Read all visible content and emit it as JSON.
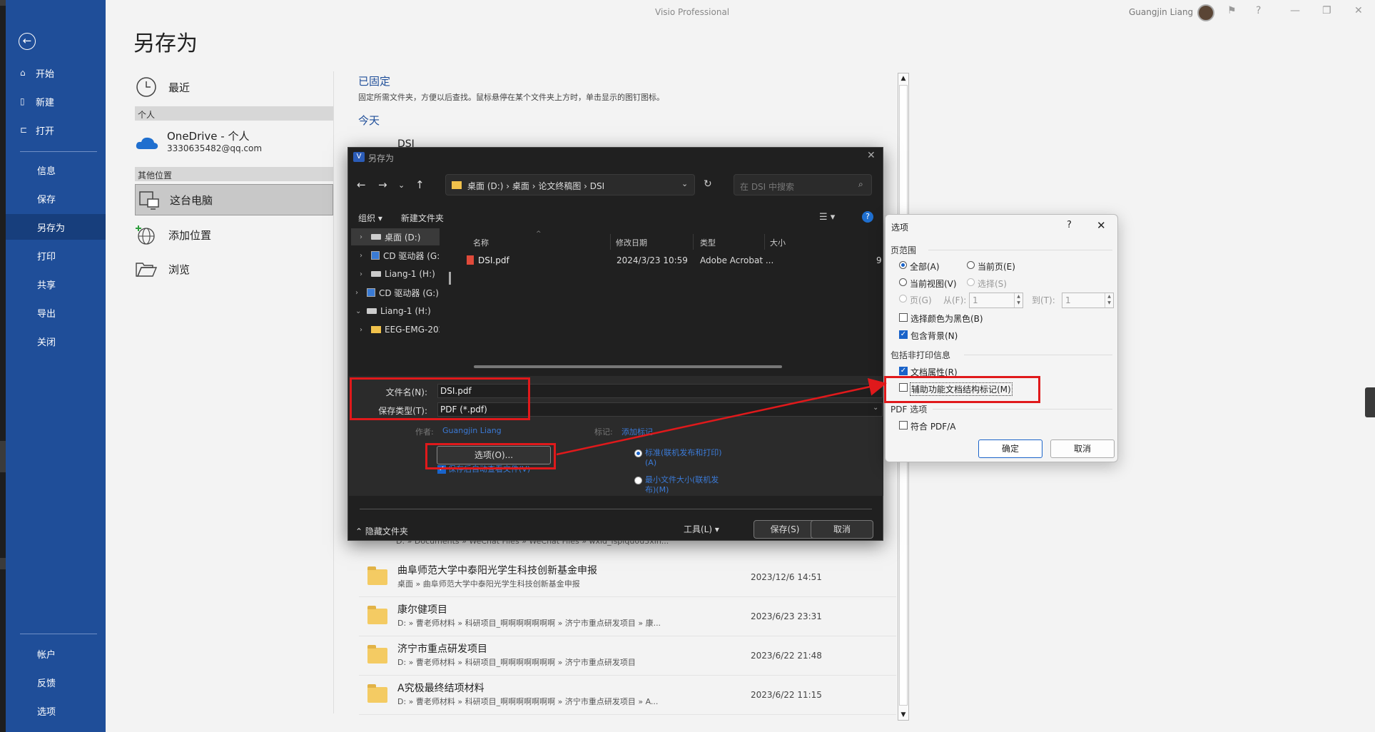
{
  "app": {
    "title": "Visio Professional",
    "user": "Guangjin Liang"
  },
  "titlebar_icons": [
    "comment-icon",
    "help-icon",
    "minimize-icon",
    "restore-icon",
    "close-icon"
  ],
  "nav": {
    "top": [
      {
        "label": "开始",
        "icon": "home-icon"
      },
      {
        "label": "新建",
        "icon": "new-icon"
      },
      {
        "label": "打开",
        "icon": "open-icon"
      }
    ],
    "mid": [
      {
        "label": "信息"
      },
      {
        "label": "保存"
      },
      {
        "label": "另存为",
        "selected": true
      },
      {
        "label": "打印"
      },
      {
        "label": "共享"
      },
      {
        "label": "导出"
      },
      {
        "label": "关闭"
      }
    ],
    "bottom": [
      {
        "label": "帐户"
      },
      {
        "label": "反馈"
      },
      {
        "label": "选项"
      }
    ]
  },
  "backstage": {
    "title": "另存为",
    "recent": "最近",
    "personal_header": "个人",
    "onedrive": {
      "name": "OneDrive - 个人",
      "account": "3330635482@qq.com"
    },
    "other_header": "其他位置",
    "this_pc": "这台电脑",
    "add_place": "添加位置",
    "browse": "浏览",
    "pinned_title": "已固定",
    "pinned_desc": "固定所需文件夹，方便以后查找。鼠标悬停在某个文件夹上方时，单击显示的图钉图标。",
    "today": "今天",
    "today_first": "DSI",
    "partial_path": "D: » Documents » WeChat Files » WeChat Files » wxid_ispiqu0u3xin...",
    "folders": [
      {
        "name": "曲阜师范大学中泰阳光学生科技创新基金申报",
        "path": "桌面 » 曲阜师范大学中泰阳光学生科技创新基金申报",
        "date": "2023/12/6 14:51"
      },
      {
        "name": "康尔健项目",
        "path": "D: » 曹老师材料 » 科研项目_啊啊啊啊啊啊啊 » 济宁市重点研发项目 » 康...",
        "date": "2023/6/23 23:31"
      },
      {
        "name": "济宁市重点研发项目",
        "path": "D: » 曹老师材料 » 科研项目_啊啊啊啊啊啊啊 » 济宁市重点研发项目",
        "date": "2023/6/22 21:48"
      },
      {
        "name": "A究极最终结项材料",
        "path": "D: » 曹老师材料 » 科研项目_啊啊啊啊啊啊啊 » 济宁市重点研发项目 » A...",
        "date": "2023/6/22 11:15"
      }
    ]
  },
  "saveas": {
    "title": "另存为",
    "breadcrumb": "桌面 (D:)  ›  桌面  ›  论文终稿图  ›  DSI",
    "search_placeholder": "在 DSI 中搜索",
    "organize": "组织 ▾",
    "new_folder": "新建文件夹",
    "tree": [
      {
        "label": "桌面 (D:)",
        "kind": "drive",
        "selected": true
      },
      {
        "label": "CD 驱动器 (G:)",
        "kind": "cd"
      },
      {
        "label": "Liang-1 (H:)",
        "kind": "drive"
      },
      {
        "label": "CD 驱动器 (G:) \\",
        "kind": "cd"
      },
      {
        "label": "Liang-1 (H:)",
        "kind": "drive",
        "expanded": true
      },
      {
        "label": "EEG-EMG-202",
        "kind": "folder"
      }
    ],
    "columns": {
      "name": "名称",
      "date": "修改日期",
      "type": "类型",
      "size": "大小"
    },
    "files": [
      {
        "name": "DSI.pdf",
        "date": "2024/3/23 10:59",
        "type": "Adobe Acrobat ...",
        "size": "9"
      }
    ],
    "filename_label": "文件名(N):",
    "filename": "DSI.pdf",
    "filetype_label": "保存类型(T):",
    "filetype": "PDF (*.pdf)",
    "author_label": "作者:",
    "author": "Guangjin Liang",
    "tags_label": "标记:",
    "tags": "添加标记",
    "options_button": "选项(O)...",
    "open_after": "保存后自动查看文件(V)",
    "opt_standard": "标准(联机发布和打印)(A)",
    "opt_min": "最小文件大小(联机发布)(M)",
    "hide_folders": "隐藏文件夹",
    "tools": "工具(L)",
    "save": "保存(S)",
    "cancel": "取消"
  },
  "options_dialog": {
    "title": "选项",
    "help": "?",
    "range_header": "页范围",
    "all": "全部(A)",
    "current_page": "当前页(E)",
    "current_view": "当前视图(V)",
    "selection": "选择(S)",
    "pages": "页(G)",
    "from_label": "从(F):",
    "from_value": "1",
    "to_label": "到(T):",
    "to_value": "1",
    "black": "选择颜色为黑色(B)",
    "background": "包含背景(N)",
    "nonprint_header": "包括非打印信息",
    "doc_props": "文档属性(R)",
    "accessibility": "辅助功能文档结构标记(M)",
    "pdf_header": "PDF 选项",
    "pdfa": "符合 PDF/A",
    "ok": "确定",
    "cancel": "取消"
  }
}
